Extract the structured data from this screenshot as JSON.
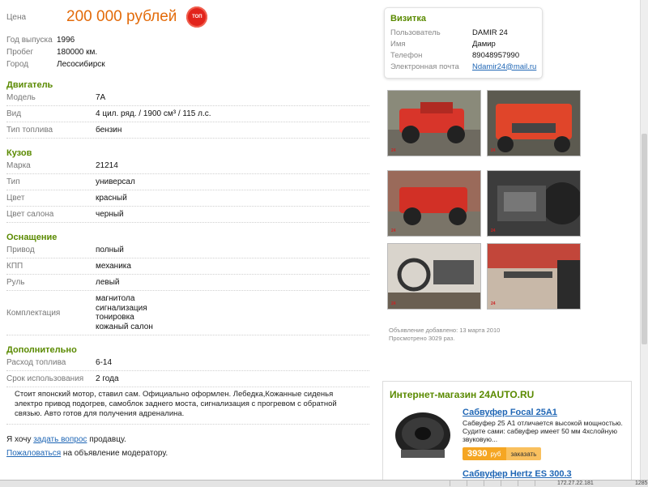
{
  "price": {
    "label": "Цена",
    "value": "200 000 рублей",
    "badge": "ТОП"
  },
  "basic": [
    {
      "label": "Год выпуска",
      "value": "1996"
    },
    {
      "label": "Пробег",
      "value": "180000 км."
    },
    {
      "label": "Город",
      "value": "Лесосибирск"
    }
  ],
  "engine": {
    "title": "Двигатель",
    "rows": [
      {
        "label": "Модель",
        "value": "7A"
      },
      {
        "label": "Вид",
        "value": "4 цил. ряд. / 1900 см³ / 115 л.с."
      },
      {
        "label": "Тип топлива",
        "value": "бензин"
      }
    ]
  },
  "body": {
    "title": "Кузов",
    "rows": [
      {
        "label": "Марка",
        "value": "21214"
      },
      {
        "label": "Тип",
        "value": "универсал"
      },
      {
        "label": "Цвет",
        "value": "красный"
      },
      {
        "label": "Цвет салона",
        "value": "черный"
      }
    ]
  },
  "equipment": {
    "title": "Оснащение",
    "rows": [
      {
        "label": "Привод",
        "value": "полный"
      },
      {
        "label": "КПП",
        "value": "механика"
      },
      {
        "label": "Руль",
        "value": "левый"
      }
    ],
    "kit": {
      "label": "Комплектация",
      "items": [
        "магнитола",
        "сигнализация",
        "тонировка",
        "кожаный салон"
      ]
    }
  },
  "extra": {
    "title": "Дополнительно",
    "rows": [
      {
        "label": "Расход топлива",
        "value": "6-14"
      },
      {
        "label": "Срок использования",
        "value": "2 года"
      }
    ]
  },
  "description": "Стоит японский мотор, ставил сам. Официально оформлен. Лебедка,Кожанные сиденья электро привод подогрев, самоблок заднего моста, сигнализация с прогревом с обратной связью. Авто готов для получения адреналина.",
  "links": {
    "ask_prefix": "Я хочу ",
    "ask_link": "задать вопрос",
    "ask_suffix": " продавцу.",
    "complain_link": "Пожаловаться",
    "complain_suffix": " на объявление модератору."
  },
  "card": {
    "title": "Визитка",
    "rows": [
      {
        "label": "Пользователь",
        "value": "DAMIR 24"
      },
      {
        "label": "Имя",
        "value": "Дамир"
      },
      {
        "label": "Телефон",
        "value": "89048957990"
      },
      {
        "label": "Электронная почта",
        "value": "Ndamir24@mail.ru"
      }
    ]
  },
  "meta": {
    "added": "Объявление добавлено: 13 марта 2010",
    "views": "Просмотрено 3029 раз."
  },
  "shop": {
    "title": "Интернет-магазин 24AUTO.RU",
    "p1_name": "Сабвуфер Focal 25A1",
    "p1_desc": "Сабвуфер 25 A1 отличается высокой мощностью. Судите сами: сабвуфер имеет 50 мм 4хслойную звуковую...",
    "p1_price": "3930",
    "p1_currency": "руб",
    "buy_label": "заказать",
    "p2_name": "Сабвуфер Hertz ES 300.3"
  },
  "status": {
    "ip": "172.27.22.181",
    "num": "1285"
  },
  "colors": {
    "accent": "#5a8a00",
    "price": "#e36b0a",
    "link": "#1f66b5",
    "car": "#d8352a"
  }
}
